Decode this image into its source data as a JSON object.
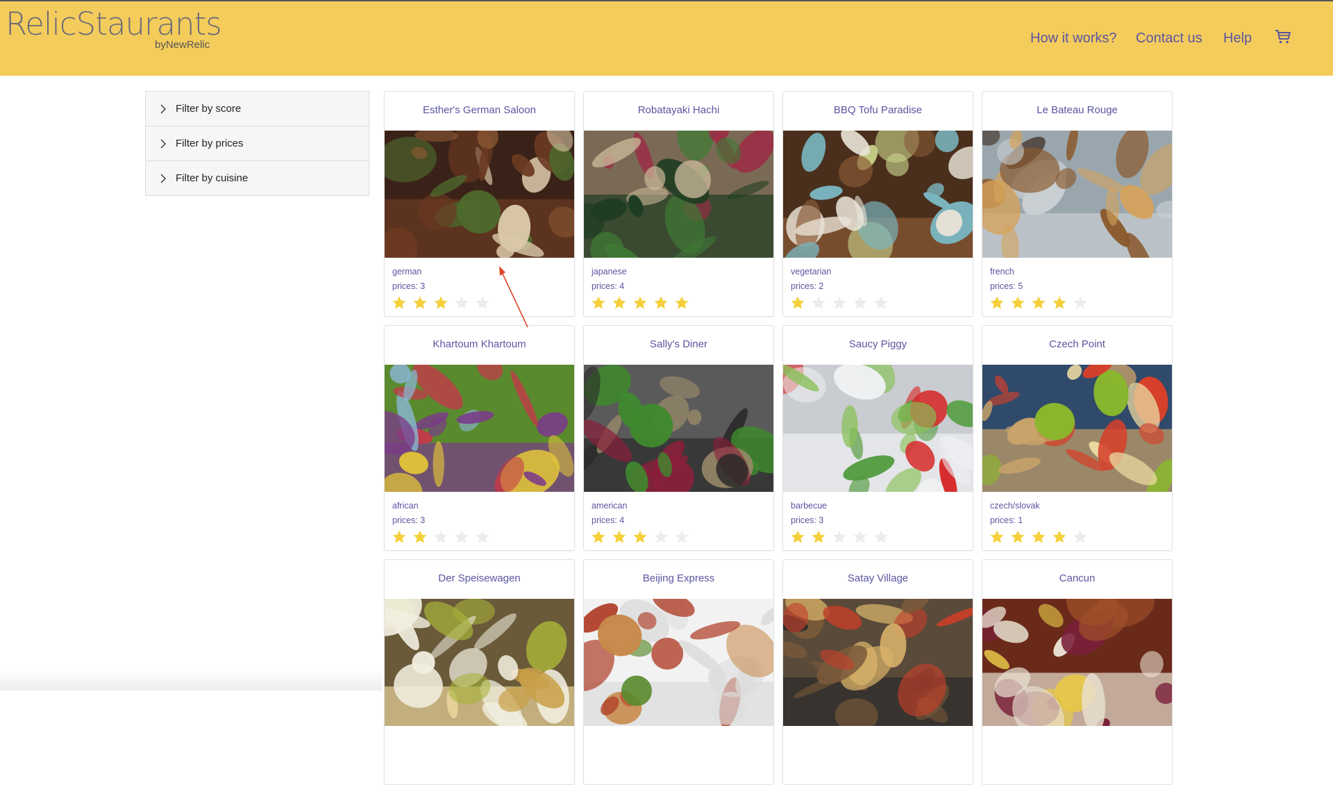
{
  "brand": {
    "name": "RelicStaurants",
    "sub": "byNewRelic"
  },
  "nav": {
    "how": "How it works?",
    "contact": "Contact us",
    "help": "Help",
    "cart_icon": "cart-icon"
  },
  "filters": [
    {
      "label": "Filter by score"
    },
    {
      "label": "Filter by prices"
    },
    {
      "label": "Filter by cuisine"
    }
  ],
  "restaurants": [
    {
      "name": "Esther's German Saloon",
      "cuisine": "german",
      "prices": "prices: 3",
      "rating": 3
    },
    {
      "name": "Robatayaki Hachi",
      "cuisine": "japanese",
      "prices": "prices: 4",
      "rating": 5
    },
    {
      "name": "BBQ Tofu Paradise",
      "cuisine": "vegetarian",
      "prices": "prices: 2",
      "rating": 1
    },
    {
      "name": "Le Bateau Rouge",
      "cuisine": "french",
      "prices": "prices: 5",
      "rating": 4
    },
    {
      "name": "Khartoum Khartoum",
      "cuisine": "african",
      "prices": "prices: 3",
      "rating": 2
    },
    {
      "name": "Sally's Diner",
      "cuisine": "american",
      "prices": "prices: 4",
      "rating": 3
    },
    {
      "name": "Saucy Piggy",
      "cuisine": "barbecue",
      "prices": "prices: 3",
      "rating": 2
    },
    {
      "name": "Czech Point",
      "cuisine": "czech/slovak",
      "prices": "prices: 1",
      "rating": 4
    },
    {
      "name": "Der Speisewagen"
    },
    {
      "name": "Beijing Express"
    },
    {
      "name": "Satay Village"
    },
    {
      "name": "Cancun"
    }
  ],
  "colors": {
    "header": "#f4cc5c",
    "link": "#5a55a0",
    "star_on": "#f5d03b",
    "star_off": "#ececec",
    "arrow": "#d9472b"
  }
}
